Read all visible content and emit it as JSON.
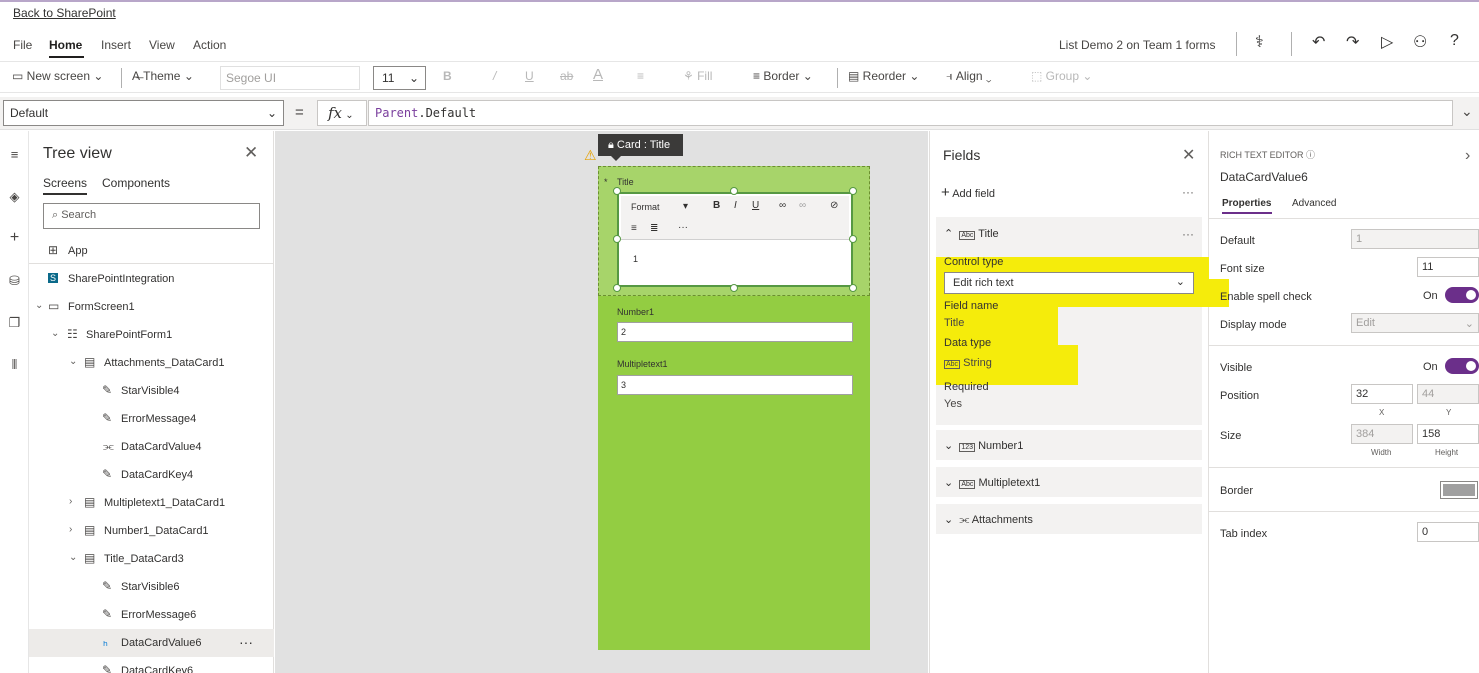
{
  "back_link": "Back to SharePoint",
  "menu": {
    "file": "File",
    "home": "Home",
    "insert": "Insert",
    "view": "View",
    "action": "Action"
  },
  "app_title": "List Demo 2 on Team 1 forms",
  "ribbon": {
    "new_screen": "New screen",
    "theme": "Theme",
    "font": "Segoe UI",
    "font_size": "11",
    "fill": "Fill",
    "border": "Border",
    "reorder": "Reorder",
    "align": "Align",
    "group": "Group"
  },
  "formula": {
    "property": "Default",
    "fx": "fx",
    "object": "Parent",
    "member": ".Default"
  },
  "tree": {
    "title": "Tree view",
    "tabs": [
      "Screens",
      "Components"
    ],
    "search_placeholder": "Search",
    "items": [
      {
        "label": "App"
      },
      {
        "label": "SharePointIntegration"
      },
      {
        "label": "FormScreen1"
      },
      {
        "label": "SharePointForm1"
      },
      {
        "label": "Attachments_DataCard1"
      },
      {
        "label": "StarVisible4"
      },
      {
        "label": "ErrorMessage4"
      },
      {
        "label": "DataCardValue4"
      },
      {
        "label": "DataCardKey4"
      },
      {
        "label": "Multipletext1_DataCard1"
      },
      {
        "label": "Number1_DataCard1"
      },
      {
        "label": "Title_DataCard3"
      },
      {
        "label": "StarVisible6"
      },
      {
        "label": "ErrorMessage6"
      },
      {
        "label": "DataCardValue6"
      },
      {
        "label": "DataCardKey6"
      }
    ],
    "more": "···"
  },
  "canvas": {
    "card_tag": "Card : Title",
    "title_label": "Title",
    "required_star": "*",
    "rte_format": "Format",
    "rte_value": "1",
    "number_label": "Number1",
    "number_value": "2",
    "multi_label": "Multipletext1",
    "multi_value": "3"
  },
  "fields": {
    "title": "Fields",
    "add_field": "Add field",
    "title_field": "Title",
    "control_type_label": "Control type",
    "control_type_value": "Edit rich text",
    "field_name_label": "Field name",
    "field_name_value": "Title",
    "data_type_label": "Data type",
    "data_type_value": "String",
    "required_label": "Required",
    "required_value": "Yes",
    "others": [
      "Number1",
      "Multipletext1",
      "Attachments"
    ],
    "highlight_color": "#f5ec0b"
  },
  "props": {
    "section": "RICH TEXT EDITOR",
    "control_name": "DataCardValue6",
    "tab_properties": "Properties",
    "tab_advanced": "Advanced",
    "default_label": "Default",
    "default_value": "1",
    "font_size_label": "Font size",
    "font_size_value": "11",
    "spell_label": "Enable spell check",
    "spell_state": "On",
    "display_label": "Display mode",
    "display_value": "Edit",
    "visible_label": "Visible",
    "visible_state": "On",
    "position_label": "Position",
    "pos_x": "32",
    "pos_y": "44",
    "x_caption": "X",
    "y_caption": "Y",
    "size_label": "Size",
    "width": "384",
    "height": "158",
    "width_caption": "Width",
    "height_caption": "Height",
    "border_label": "Border",
    "tab_index_label": "Tab index",
    "tab_index_value": "0",
    "toggle_color": "#6b2f8a"
  },
  "screen_color": "#93cd42"
}
